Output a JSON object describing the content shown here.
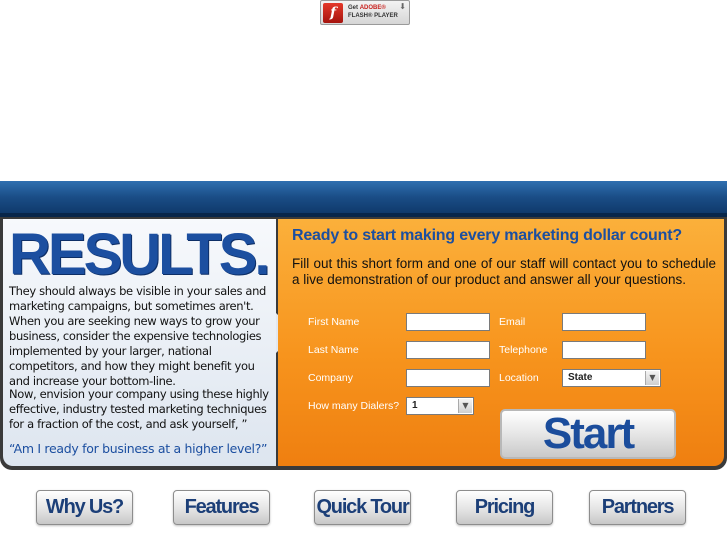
{
  "flash_badge": {
    "line1_prefix": "Get",
    "line1_brand": "ADOBE®",
    "line2": "FLASH® PLAYER",
    "logo_glyph": "f",
    "icon": "flash-logo-icon"
  },
  "left": {
    "title": "RESULTS.",
    "intro": "They should always be visible in your sales and marketing campaigns, but sometimes aren't. When you are seeking new ways to grow your business, consider the expensive technologies implemented by your larger, national competitors, and how they might benefit you and increase your bottom-line.",
    "envision": "Now, envision your company using these highly effective, industry tested marketing techniques for a fraction of the cost, and ask yourself, ”",
    "question": "“Am I ready for business at a higher level?”"
  },
  "form": {
    "heading": "Ready to start making every marketing dollar count?",
    "subheading": "Fill out this short form and one of our staff will contact you to schedule a live demonstration of our product and answer all your questions.",
    "labels": {
      "first_name": "First Name",
      "email": "Email",
      "last_name": "Last Name",
      "telephone": "Telephone",
      "company": "Company",
      "location": "Location",
      "dialers": "How many Dialers?"
    },
    "values": {
      "first_name": "",
      "email": "",
      "last_name": "",
      "telephone": "",
      "company": ""
    },
    "location_selected": "State",
    "dialers_selected": "1",
    "start_label": "Start"
  },
  "nav": [
    "Why Us?",
    "Features",
    "Quick Tour",
    "Pricing",
    "Partners"
  ],
  "colors": {
    "header_blue": "#1a4d86",
    "title_blue": "#1c4fa0",
    "orange": "#f7941d"
  }
}
